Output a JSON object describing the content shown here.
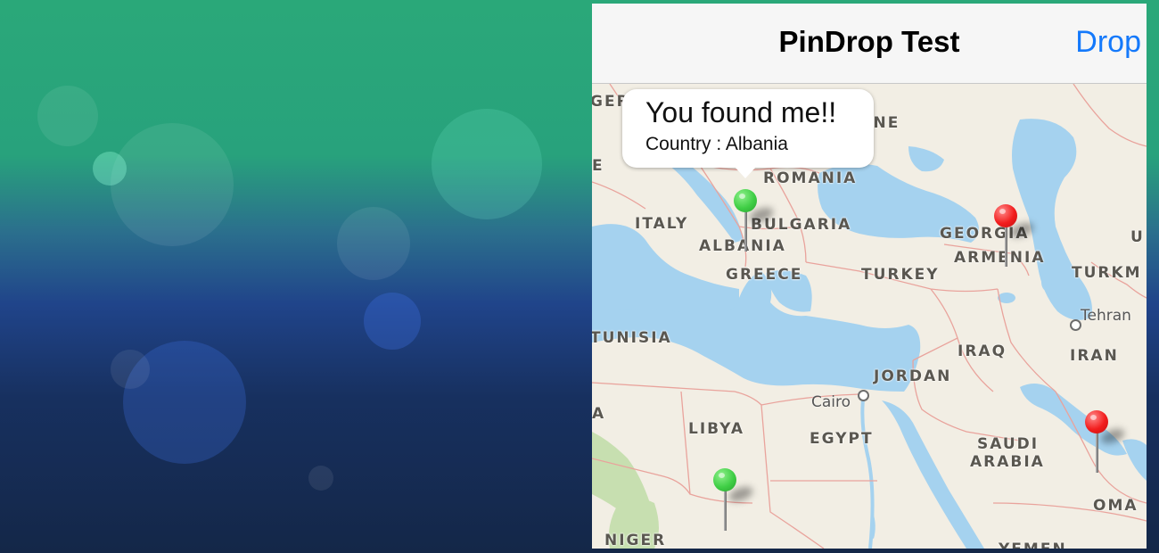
{
  "navbar": {
    "title": "PinDrop Test",
    "drop_label": "Drop"
  },
  "callout": {
    "title": "You found me!!",
    "subtitle": "Country : Albania"
  },
  "map": {
    "country_labels": [
      "GERMANY",
      "UKRAINE",
      "ROMANIA",
      "ITALY",
      "BULGARIA",
      "ALBANIA",
      "GREECE",
      "TURKEY",
      "GEORGIA",
      "ARMENIA",
      "TURKM",
      "U",
      "TUNISIA",
      "IRAQ",
      "IRAN",
      "JORDAN",
      "LIBYA",
      "EGYPT",
      "SAUDI",
      "ARABIA",
      "NIGER",
      "OMA",
      "YEMEN",
      "E",
      "A"
    ],
    "city_labels": [
      "Tehran",
      "Cairo"
    ]
  },
  "pins": [
    {
      "color": "green",
      "label": "Albania"
    },
    {
      "color": "red",
      "label": "Georgia"
    },
    {
      "color": "red",
      "label": "Qatar"
    },
    {
      "color": "green",
      "label": "Niger"
    }
  ],
  "colors": {
    "water": "#a5d2ef",
    "land": "#f2eee4",
    "border": "#e9a39c",
    "tint": "#1479fb",
    "pin_green": "#3fce45",
    "pin_red": "#f21d1d"
  }
}
